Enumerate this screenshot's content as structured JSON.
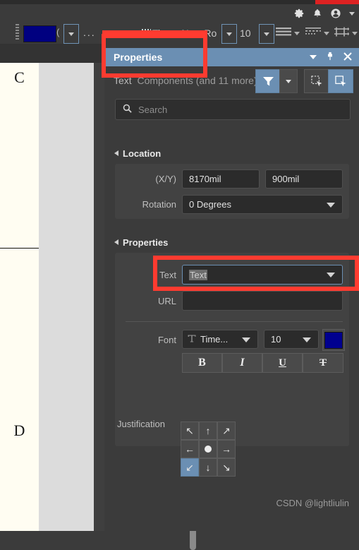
{
  "window": {
    "watermark": "CSDN @lightliulin"
  },
  "system_bar": {
    "icons": [
      {
        "name": "gear-icon",
        "label": "Settings"
      },
      {
        "name": "bell-icon",
        "label": "Notifications"
      },
      {
        "name": "user-avatar-icon",
        "label": "Account"
      },
      {
        "name": "chevron-down-icon",
        "label": "Account menu"
      }
    ]
  },
  "format_toolbar": {
    "color_swatch": "#000080",
    "color_swatch_label": "(",
    "overflow_label": "...",
    "font_name": "Times New Ro",
    "font_size": "10",
    "icons": [
      {
        "name": "line-style-icon",
        "label": "Line style"
      },
      {
        "name": "dashed-line-style-icon",
        "label": "Dash style"
      },
      {
        "name": "arrow-style-icon",
        "label": "Arrow style"
      }
    ]
  },
  "canvas": {
    "row_labels": [
      "C",
      "D"
    ]
  },
  "panel": {
    "title": "Properties",
    "title_buttons": [
      {
        "name": "panel-menu-chevron-icon",
        "label": "Panel menu"
      },
      {
        "name": "pin-icon",
        "label": "Pin panel"
      },
      {
        "name": "close-icon",
        "label": "Close panel"
      }
    ],
    "object_selector": {
      "object_type": "Text",
      "scope": "Components (and 11 more)"
    },
    "filter_button": {
      "name": "filter-icon",
      "label": "Filter"
    },
    "filter_dropdown": {
      "name": "chevron-down-icon",
      "label": "Filter options"
    },
    "select_buttons": [
      {
        "name": "select-all-icon",
        "label": "Select all"
      },
      {
        "name": "select-object-icon",
        "label": "Select object"
      }
    ],
    "search": {
      "placeholder": "Search",
      "value": "",
      "icon": "search-icon"
    },
    "sections": {
      "location": {
        "title": "Location",
        "xy_label": "(X/Y)",
        "x_value": "8170mil",
        "y_value": "900mil",
        "rotation_label": "Rotation",
        "rotation_value": "0 Degrees"
      },
      "properties": {
        "title": "Properties",
        "text_label": "Text",
        "text_value": "Text",
        "url_label": "URL",
        "url_value": "",
        "font_label": "Font",
        "font_family": "Time...",
        "font_size": "10",
        "font_color": "#00008F",
        "style_buttons": [
          {
            "name": "bold-button",
            "label": "B"
          },
          {
            "name": "italic-button",
            "label": "I"
          },
          {
            "name": "underline-button",
            "label": "U"
          },
          {
            "name": "strikethrough-button",
            "label": "T"
          }
        ],
        "justification_label": "Justification",
        "justification_cells": [
          {
            "name": "justify-top-left",
            "glyph": "↖",
            "selected": false
          },
          {
            "name": "justify-top-center",
            "glyph": "↑",
            "selected": false
          },
          {
            "name": "justify-top-right",
            "glyph": "↗",
            "selected": false
          },
          {
            "name": "justify-middle-left",
            "glyph": "←",
            "selected": false
          },
          {
            "name": "justify-middle-center",
            "glyph": "●",
            "selected": false
          },
          {
            "name": "justify-middle-right",
            "glyph": "→",
            "selected": false
          },
          {
            "name": "justify-bottom-left",
            "glyph": "↙",
            "selected": true
          },
          {
            "name": "justify-bottom-center",
            "glyph": "↓",
            "selected": false
          },
          {
            "name": "justify-bottom-right",
            "glyph": "↘",
            "selected": false
          }
        ]
      }
    }
  }
}
